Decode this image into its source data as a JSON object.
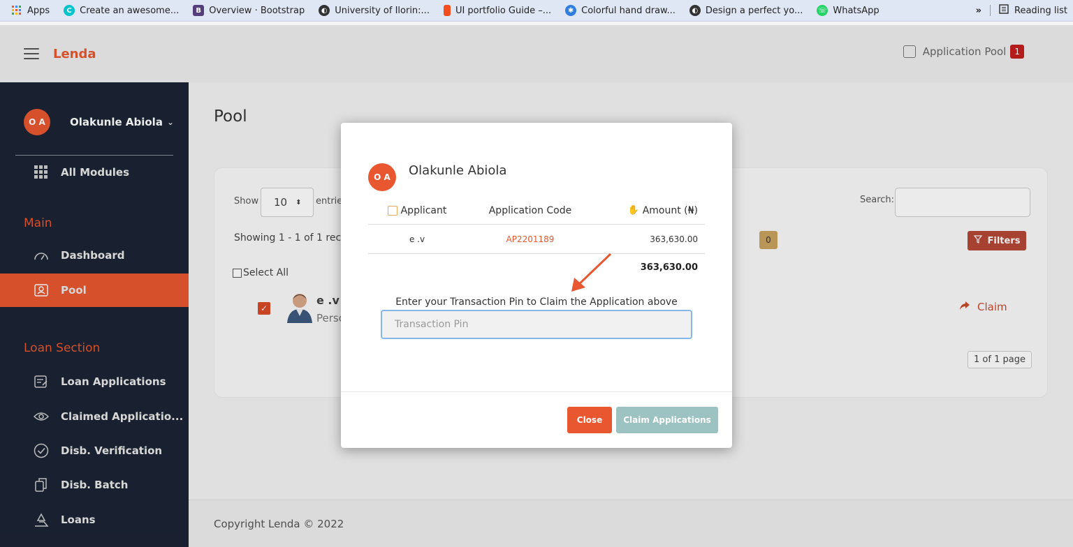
{
  "bookmarks": {
    "items": [
      {
        "label": "Apps",
        "icon": "apps-grid-icon",
        "color": "#e8572f"
      },
      {
        "label": "Create an awesome...",
        "icon": "canva-icon",
        "color": "#00c4cc"
      },
      {
        "label": "Overview · Bootstrap",
        "icon": "bootstrap-icon",
        "color": "#563d7c"
      },
      {
        "label": "University of Ilorin:...",
        "icon": "globe-icon",
        "color": "#333333"
      },
      {
        "label": "UI portfolio Guide –...",
        "icon": "figma-icon",
        "color": "#f24e1e"
      },
      {
        "label": "Colorful hand draw...",
        "icon": "gear-icon",
        "color": "#2f7de1"
      },
      {
        "label": "Design a perfect yo...",
        "icon": "globe-icon",
        "color": "#333333"
      },
      {
        "label": "WhatsApp",
        "icon": "whatsapp-icon",
        "color": "#25d366"
      }
    ],
    "more": "»",
    "reading_list": "Reading list"
  },
  "header": {
    "logo": "Lenda",
    "pool_label": "Application Pool",
    "pool_count": "1"
  },
  "sidebar": {
    "user_initials": "O A",
    "user_name": "Olakunle Abiola",
    "all_modules": "All Modules",
    "section_main": "Main",
    "items_main": [
      {
        "label": "Dashboard"
      },
      {
        "label": "Pool"
      }
    ],
    "section_loan": "Loan Section",
    "items_loan": [
      {
        "label": "Loan Applications"
      },
      {
        "label": "Claimed Applicatio..."
      },
      {
        "label": "Disb. Verification"
      },
      {
        "label": "Disb. Batch"
      },
      {
        "label": "Loans"
      }
    ]
  },
  "main": {
    "title": "Pool",
    "show_label": "Show",
    "show_value": "10",
    "entries_label": "entrie",
    "showing_text": "Showing 1 - 1 of 1 recor",
    "select_all": "Select All",
    "row_name": "e .v",
    "row_type": "Perso",
    "zero_badge": "0",
    "search_label": "Search:",
    "filters_label": "Filters",
    "claim_label": "Claim",
    "page_info": "1 of 1 page",
    "footer": "Copyright Lenda © 2022"
  },
  "modal": {
    "avatar_initials": "O A",
    "name": "Olakunle Abiola",
    "columns": {
      "applicant": "Applicant",
      "code": "Application Code",
      "amount": "Amount (₦)"
    },
    "row": {
      "applicant": "e .v",
      "code": "AP2201189",
      "amount": "363,630.00"
    },
    "total": "363,630.00",
    "pin_label": "Enter your Transaction Pin to Claim the Application above",
    "pin_placeholder": "Transaction Pin",
    "close_label": "Close",
    "claim_label": "Claim Applications"
  },
  "colors": {
    "accent": "#e8572f",
    "sidebar_bg": "#1c2333",
    "claim_disabled": "#9cc2c2"
  }
}
